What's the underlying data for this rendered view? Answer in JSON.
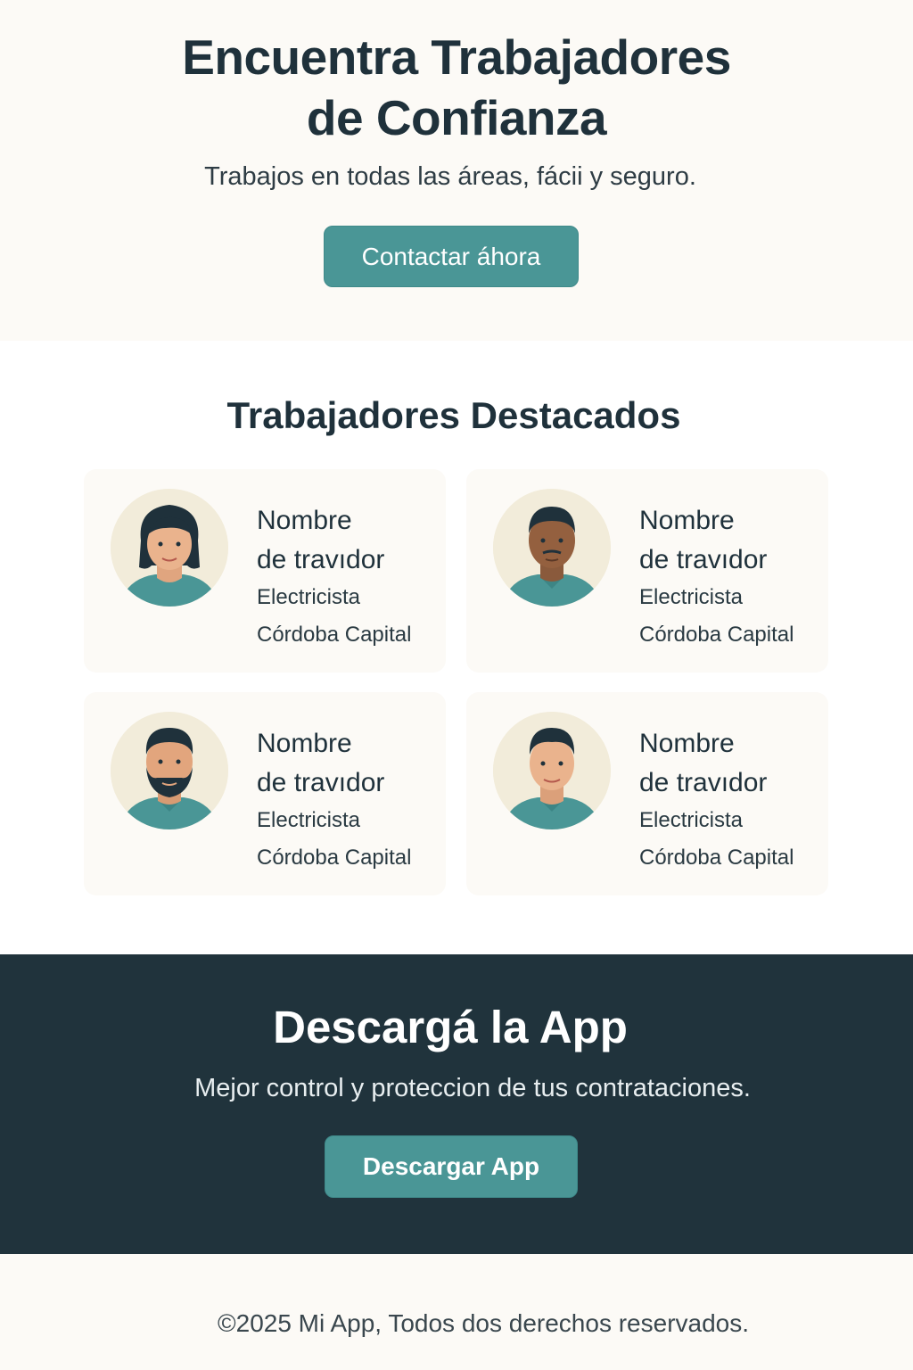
{
  "hero": {
    "title_line1": "Encuentra Trabajadores",
    "title_line2": "de Confianza",
    "subtitle": "Trabajos en todas las áreas, fácii y seguro.",
    "cta_label": "Contactar áhora"
  },
  "featured": {
    "heading": "Trabajadores Destacados",
    "workers": [
      {
        "name_line1": "Nombre",
        "name_line2": "de travıdor",
        "role": "Electricista",
        "location": "Córdoba Capital"
      },
      {
        "name_line1": "Nombre",
        "name_line2": "de travıdor",
        "role": "Electricista",
        "location": "Córdoba Capital"
      },
      {
        "name_line1": "Nombre",
        "name_line2": "de travıdor",
        "role": "Electricista",
        "location": "Córdoba Capital"
      },
      {
        "name_line1": "Nombre",
        "name_line2": "de travıdor",
        "role": "Electricista",
        "location": "Córdoba Capital"
      }
    ]
  },
  "download": {
    "heading": "Descargá la App",
    "subtitle": "Mejor control y proteccion de tus contrataciones.",
    "button_label": "Descargar App"
  },
  "footer": {
    "copyright": "©2025  Mi App, Todos dos derechos reservados."
  },
  "colors": {
    "accent": "#4a9696",
    "dark": "#20333c",
    "background": "#fcfaf6"
  },
  "icons": [
    "avatar-woman-icon",
    "avatar-man-dark-icon",
    "avatar-man-beard-icon",
    "avatar-man-icon"
  ]
}
